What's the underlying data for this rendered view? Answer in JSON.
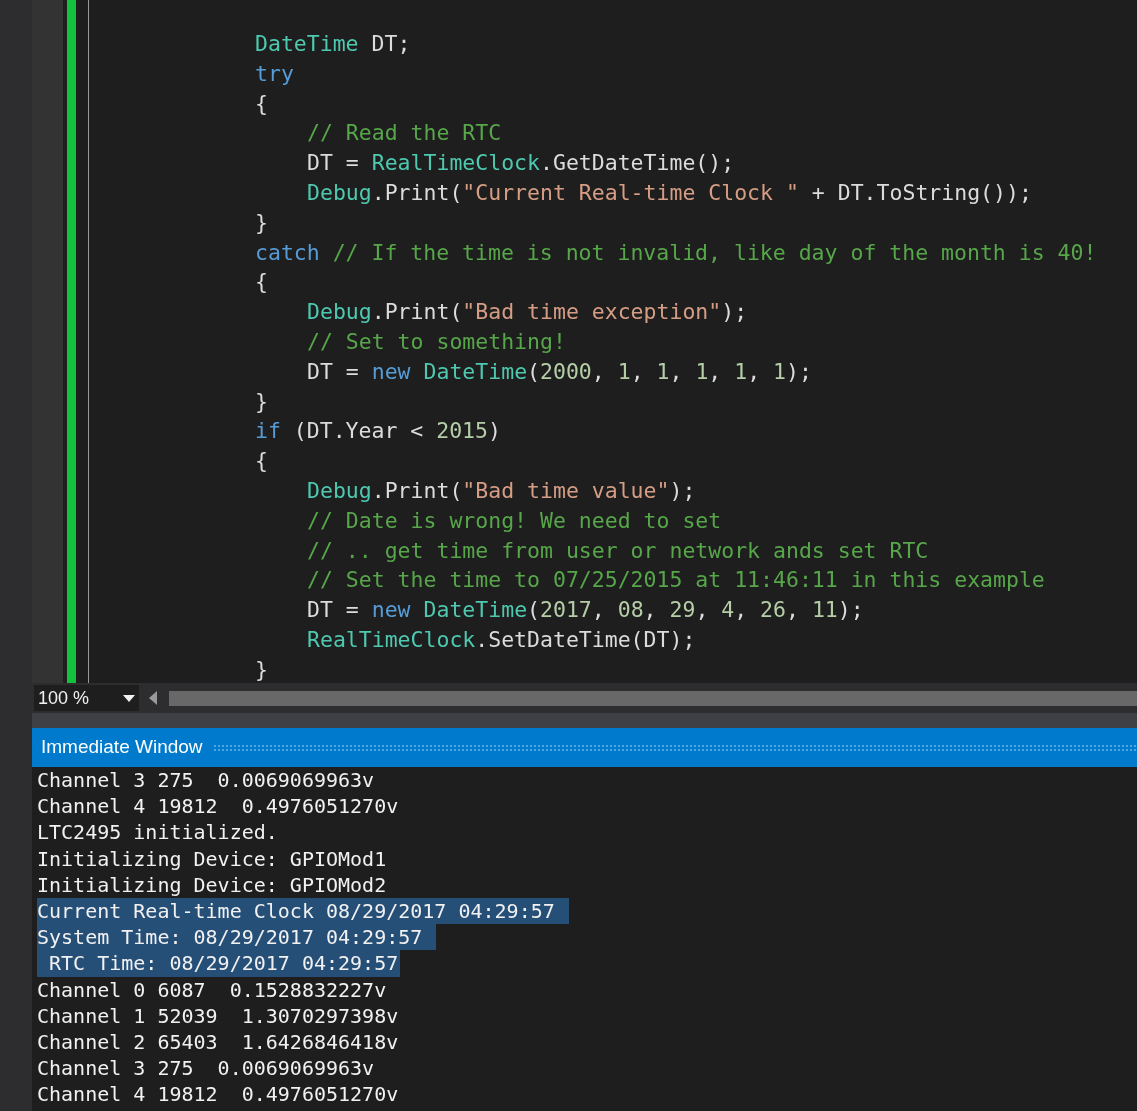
{
  "editor": {
    "lines": [
      {
        "tokens": [
          {
            "kind": "type",
            "text": "DateTime"
          },
          {
            "kind": "plain",
            "text": " DT;"
          }
        ]
      },
      {
        "tokens": [
          {
            "kind": "keyword",
            "text": "try"
          }
        ]
      },
      {
        "tokens": [
          {
            "kind": "plain",
            "text": "{"
          }
        ],
        "children": [
          {
            "tokens": [
              {
                "kind": "comment",
                "text": "// Read the RTC"
              }
            ]
          },
          {
            "tokens": [
              {
                "kind": "plain",
                "text": "DT = "
              },
              {
                "kind": "type",
                "text": "RealTimeClock"
              },
              {
                "kind": "plain",
                "text": ".GetDateTime();"
              }
            ]
          },
          {
            "tokens": [
              {
                "kind": "type",
                "text": "Debug"
              },
              {
                "kind": "plain",
                "text": ".Print("
              },
              {
                "kind": "string",
                "text": "\"Current Real-time Clock \""
              },
              {
                "kind": "plain",
                "text": " + DT.ToString());"
              }
            ]
          }
        ]
      },
      {
        "tokens": [
          {
            "kind": "plain",
            "text": "}"
          }
        ]
      },
      {
        "tokens": [
          {
            "kind": "keyword",
            "text": "catch"
          },
          {
            "kind": "comment",
            "text": " // If the time is not invalid, like day of the month is 40!"
          }
        ]
      },
      {
        "tokens": [
          {
            "kind": "plain",
            "text": "{"
          }
        ],
        "children": [
          {
            "tokens": [
              {
                "kind": "type",
                "text": "Debug"
              },
              {
                "kind": "plain",
                "text": ".Print("
              },
              {
                "kind": "string",
                "text": "\"Bad time exception\""
              },
              {
                "kind": "plain",
                "text": ");"
              }
            ]
          },
          {
            "tokens": [
              {
                "kind": "comment",
                "text": "// Set to something!"
              }
            ]
          },
          {
            "tokens": [
              {
                "kind": "plain",
                "text": "DT = "
              },
              {
                "kind": "keyword",
                "text": "new"
              },
              {
                "kind": "type",
                "text": " DateTime"
              },
              {
                "kind": "plain",
                "text": "("
              },
              {
                "kind": "number",
                "text": "2000"
              },
              {
                "kind": "plain",
                "text": ", "
              },
              {
                "kind": "number",
                "text": "1"
              },
              {
                "kind": "plain",
                "text": ", "
              },
              {
                "kind": "number",
                "text": "1"
              },
              {
                "kind": "plain",
                "text": ", "
              },
              {
                "kind": "number",
                "text": "1"
              },
              {
                "kind": "plain",
                "text": ", "
              },
              {
                "kind": "number",
                "text": "1"
              },
              {
                "kind": "plain",
                "text": ", "
              },
              {
                "kind": "number",
                "text": "1"
              },
              {
                "kind": "plain",
                "text": ");"
              }
            ]
          }
        ]
      },
      {
        "tokens": [
          {
            "kind": "plain",
            "text": "}"
          }
        ]
      },
      {
        "tokens": [
          {
            "kind": "keyword",
            "text": "if"
          },
          {
            "kind": "plain",
            "text": " (DT.Year < "
          },
          {
            "kind": "number",
            "text": "2015"
          },
          {
            "kind": "plain",
            "text": ")"
          }
        ]
      },
      {
        "tokens": [
          {
            "kind": "plain",
            "text": "{"
          }
        ],
        "children": [
          {
            "tokens": [
              {
                "kind": "type",
                "text": "Debug"
              },
              {
                "kind": "plain",
                "text": ".Print("
              },
              {
                "kind": "string",
                "text": "\"Bad time value\""
              },
              {
                "kind": "plain",
                "text": ");"
              }
            ]
          },
          {
            "tokens": [
              {
                "kind": "comment",
                "text": "// Date is wrong! We need to set"
              }
            ]
          },
          {
            "tokens": [
              {
                "kind": "comment",
                "text": "// .. get time from user or network ands set RTC"
              }
            ]
          },
          {
            "tokens": [
              {
                "kind": "comment",
                "text": "// Set the time to 07/25/2015 at 11:46:11 in this example"
              }
            ]
          },
          {
            "tokens": [
              {
                "kind": "plain",
                "text": "DT = "
              },
              {
                "kind": "keyword",
                "text": "new"
              },
              {
                "kind": "type",
                "text": " DateTime"
              },
              {
                "kind": "plain",
                "text": "("
              },
              {
                "kind": "number",
                "text": "2017"
              },
              {
                "kind": "plain",
                "text": ", "
              },
              {
                "kind": "number",
                "text": "08"
              },
              {
                "kind": "plain",
                "text": ", "
              },
              {
                "kind": "number",
                "text": "29"
              },
              {
                "kind": "plain",
                "text": ", "
              },
              {
                "kind": "number",
                "text": "4"
              },
              {
                "kind": "plain",
                "text": ", "
              },
              {
                "kind": "number",
                "text": "26"
              },
              {
                "kind": "plain",
                "text": ", "
              },
              {
                "kind": "number",
                "text": "11"
              },
              {
                "kind": "plain",
                "text": ");"
              }
            ]
          },
          {
            "tokens": [
              {
                "kind": "type",
                "text": "RealTimeClock"
              },
              {
                "kind": "plain",
                "text": ".SetDateTime(DT);"
              }
            ]
          }
        ]
      },
      {
        "tokens": [
          {
            "kind": "plain",
            "text": "}"
          }
        ]
      }
    ]
  },
  "zoom": {
    "value": "100 %"
  },
  "immediate_window": {
    "title": "Immediate Window",
    "lines": [
      {
        "text": "Channel 3 275  0.0069069963v",
        "selected": false
      },
      {
        "text": "Channel 4 19812  0.4976051270v",
        "selected": false
      },
      {
        "text": "LTC2495 initialized.",
        "selected": false
      },
      {
        "text": "Initializing Device: GPIOMod1",
        "selected": false
      },
      {
        "text": "Initializing Device: GPIOMod2",
        "selected": false
      },
      {
        "text": "Current Real-time Clock 08/29/2017 04:29:57 ",
        "selected": true
      },
      {
        "text": "System Time: 08/29/2017 04:29:57 ",
        "selected": true
      },
      {
        "text": " RTC Time: 08/29/2017 04:29:57",
        "selected": true
      },
      {
        "text": "Channel 0 6087  0.1528832227v",
        "selected": false
      },
      {
        "text": "Channel 1 52039  1.3070297398v",
        "selected": false
      },
      {
        "text": "Channel 2 65403  1.6426846418v",
        "selected": false
      },
      {
        "text": "Channel 3 275  0.0069069963v",
        "selected": false
      },
      {
        "text": "Channel 4 19812  0.4976051270v",
        "selected": false
      }
    ]
  }
}
